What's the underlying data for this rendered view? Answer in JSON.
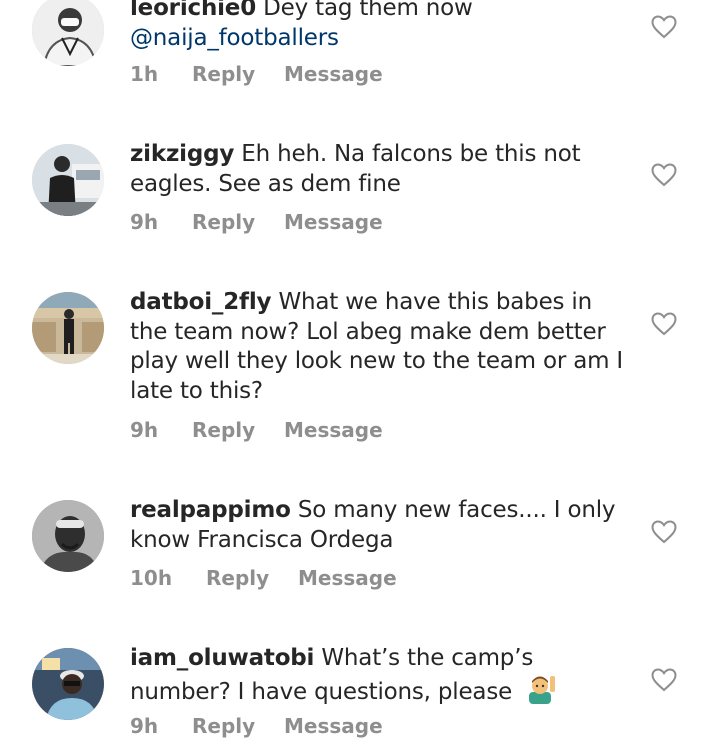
{
  "comments": [
    {
      "username": "leorichie0",
      "text": "Dey tag them now",
      "mention": "@naija_footballers",
      "time": "1h",
      "reply_label": "Reply",
      "message_label": "Message",
      "avatar_icon": "user-avatar-icon"
    },
    {
      "username": "zikziggy",
      "text": "Eh heh. Na falcons be this not eagles. See as dem fine",
      "time": "9h",
      "reply_label": "Reply",
      "message_label": "Message",
      "avatar_icon": "user-avatar-icon"
    },
    {
      "username": "datboi_2fly",
      "text": "What we have this babes in the team now? Lol abeg make dem better play well they look new to the team or am I late to this?",
      "time": "9h",
      "reply_label": "Reply",
      "message_label": "Message",
      "avatar_icon": "user-avatar-icon"
    },
    {
      "username": "realpappimo",
      "text": "So many new faces.... I only know Francisca Ordega",
      "time": "10h",
      "reply_label": "Reply",
      "message_label": "Message",
      "avatar_icon": "user-avatar-icon"
    },
    {
      "username": "iam_oluwatobi",
      "text": "What’s the camp’s number? I have questions, please",
      "emoji": "man-raising-hand-emoji",
      "time": "9h",
      "reply_label": "Reply",
      "message_label": "Message",
      "avatar_icon": "user-avatar-icon"
    }
  ],
  "colors": {
    "text": "#262626",
    "meta": "#8e8e8e",
    "mention": "#00376b",
    "heart": "#8e8e8e"
  }
}
